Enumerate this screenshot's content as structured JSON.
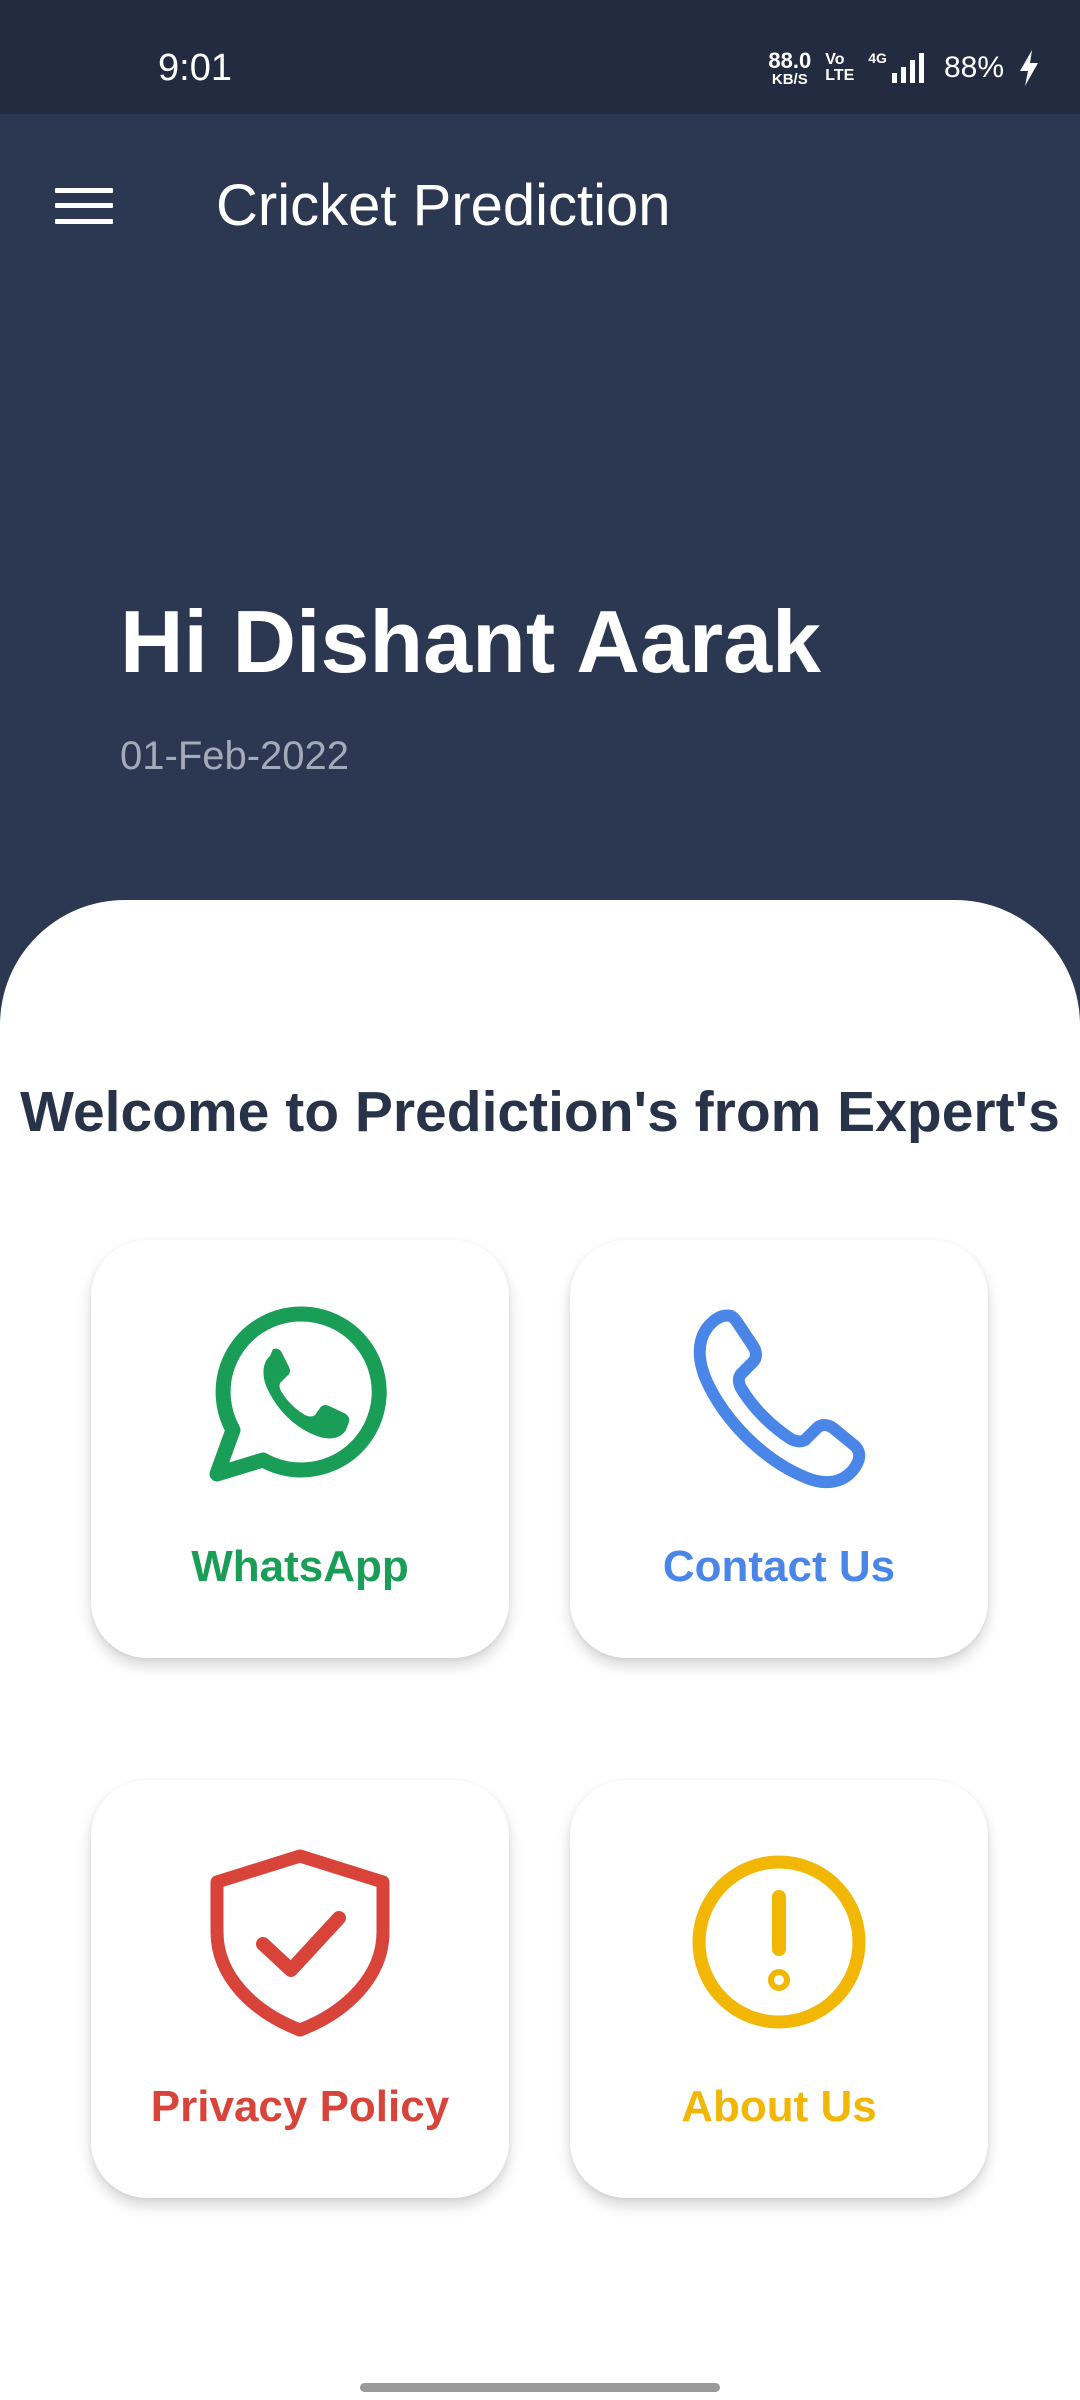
{
  "status_bar": {
    "time": "9:01",
    "net_speed_value": "88.0",
    "net_speed_unit": "KB/S",
    "volte_top": "Vo",
    "volte_bottom": "LTE",
    "network": "4G",
    "battery": "88%"
  },
  "toolbar": {
    "title": "Cricket Prediction",
    "menu_icon": "hamburger-menu-icon"
  },
  "header": {
    "greeting": "Hi Dishant Aarak",
    "date": "01-Feb-2022"
  },
  "main": {
    "welcome": "Welcome to Prediction's from Expert's",
    "cards": [
      {
        "label": "WhatsApp",
        "icon": "whatsapp-icon",
        "color": "#1a9e57"
      },
      {
        "label": "Contact Us",
        "icon": "phone-icon",
        "color": "#4a86e8"
      },
      {
        "label": "Privacy Policy",
        "icon": "shield-check-icon",
        "color": "#d9443a"
      },
      {
        "label": "About Us",
        "icon": "info-alert-icon",
        "color": "#f2b705"
      }
    ]
  },
  "colors": {
    "header_bg": "#2c3751",
    "status_bg": "#232b41",
    "welcome_text": "#283349",
    "date_text": "#a3abbb"
  }
}
